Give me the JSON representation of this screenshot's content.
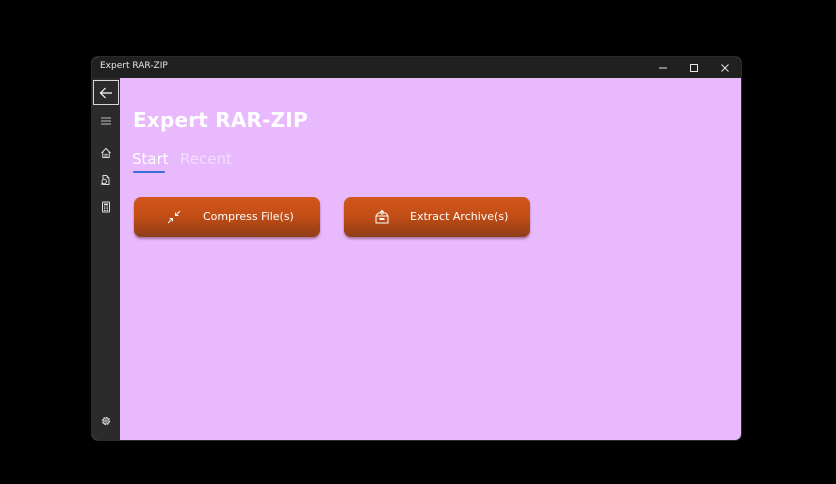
{
  "window": {
    "title": "Expert RAR-ZIP",
    "controls": {
      "minimize_icon": "minimize-icon",
      "maximize_icon": "maximize-icon",
      "close_icon": "close-icon"
    }
  },
  "sidebar": {
    "items": [
      {
        "icon": "back-arrow-icon"
      },
      {
        "icon": "hamburger-menu-icon"
      },
      {
        "icon": "home-icon"
      },
      {
        "icon": "file-search-icon"
      },
      {
        "icon": "calculator-icon"
      },
      {
        "icon": "gear-icon"
      }
    ]
  },
  "main": {
    "title": "Expert RAR-ZIP",
    "tabs": [
      {
        "label": "Start",
        "selected": true
      },
      {
        "label": "Recent",
        "selected": false
      }
    ],
    "actions": [
      {
        "label": "Compress File(s)",
        "icon": "compress-arrows-icon"
      },
      {
        "label": "Extract Archive(s)",
        "icon": "extract-box-icon"
      }
    ]
  },
  "colors": {
    "content_background": "#e8b9fd",
    "sidebar_background": "#2b2b2b",
    "titlebar_background": "#202020",
    "button_gradient_top": "#d2571d",
    "button_gradient_bottom": "#8e3d18",
    "tab_underline": "#3a6fd8",
    "tab_inactive_text": "#f3dcfe"
  }
}
